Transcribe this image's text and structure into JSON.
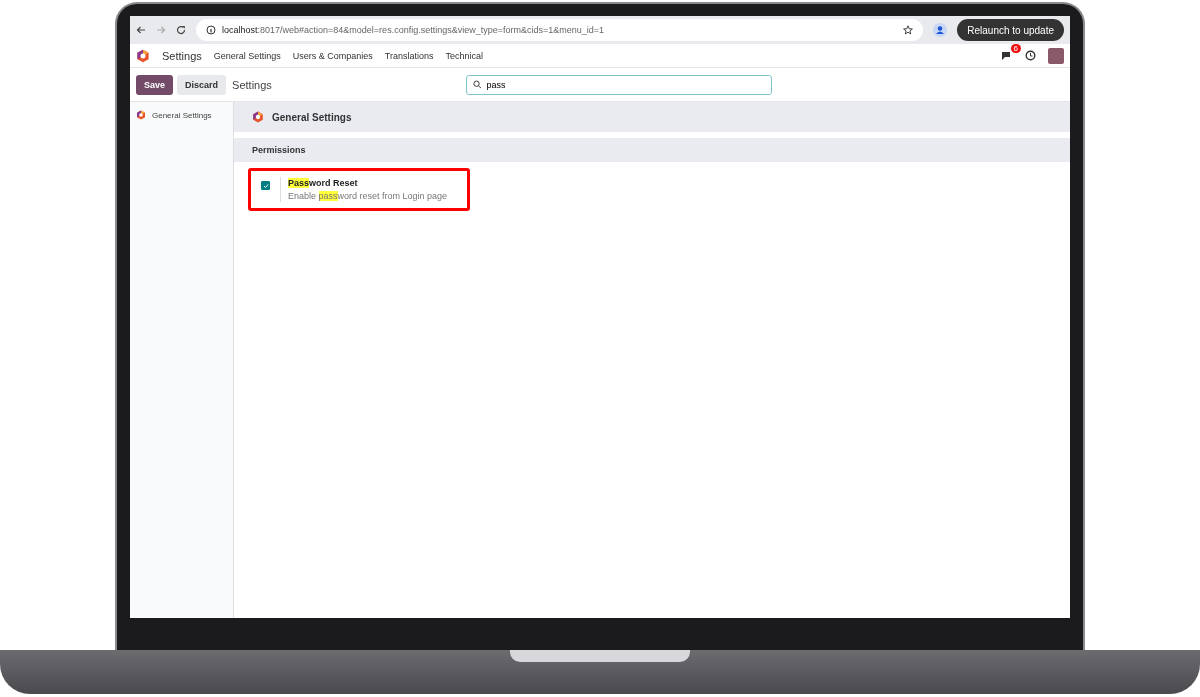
{
  "browser": {
    "url_host": "localhost",
    "url_rest": ":8017/web#action=84&model=res.config.settings&view_type=form&cids=1&menu_id=1",
    "relaunch": "Relaunch to update"
  },
  "navbar": {
    "app": "Settings",
    "menu": [
      "General Settings",
      "Users & Companies",
      "Translations",
      "Technical"
    ],
    "messages_badge": "6"
  },
  "control_panel": {
    "save": "Save",
    "discard": "Discard",
    "breadcrumb": "Settings",
    "search": {
      "value": "pass"
    }
  },
  "sidebar": {
    "items": [
      {
        "label": "General Settings",
        "selected": false
      }
    ]
  },
  "app_header": "General Settings",
  "sections": [
    {
      "title": "Permissions",
      "settings": [
        {
          "title": [
            {
              "text": "Pass",
              "highlighted": true
            },
            {
              "text": "word Reset",
              "highlighted": false
            }
          ],
          "description": [
            {
              "text": "Enable ",
              "highlighted": false
            },
            {
              "text": "pass",
              "highlighted": true
            },
            {
              "text": "word reset from Login page",
              "highlighted": false
            }
          ],
          "checked": true
        }
      ]
    }
  ]
}
